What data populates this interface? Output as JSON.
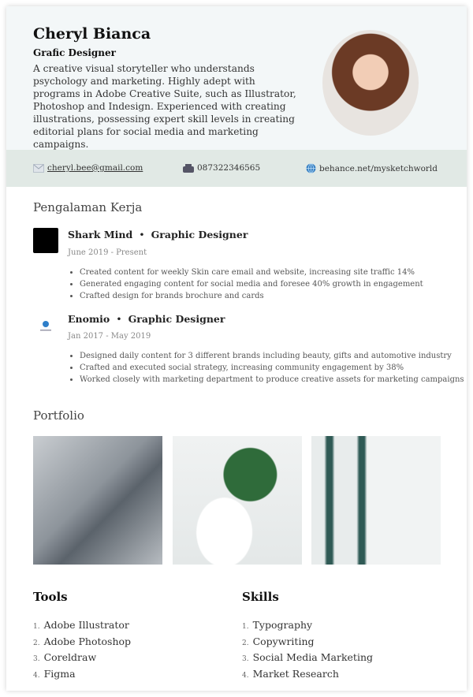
{
  "header": {
    "name": "Cheryl Bianca",
    "title": "Grafic Designer",
    "bio": "A creative visual storyteller who understands psychology and marketing. Highly adept with programs in Adobe Creative Suite, such as Illustrator, Photoshop and Indesign. Experienced with creating illustrations, possessing expert skill levels in creating editorial plans for social media and marketing campaigns."
  },
  "contacts": {
    "email": "cheryl.bee@gmail.com",
    "phone": "087322346565",
    "website": "behance.net/mysketchworld"
  },
  "experience": {
    "heading": "Pengalaman Kerja",
    "jobs": [
      {
        "company": "Shark Mind",
        "role": "Graphic Designer",
        "dates": "June 2019 - Present",
        "bullets": [
          "Created content for weekly Skin care email and website, increasing site traffic 14%",
          "Generated engaging content for social media and foresee  40% growth in engagement",
          "Crafted design for brands brochure and cards"
        ]
      },
      {
        "company": "Enomio",
        "role": "Graphic Designer",
        "dates": "Jan 2017 - May 2019",
        "bullets": [
          "Designed daily content for 3 different brands including beauty, gifts and automotive industry",
          "Crafted and executed social strategy, increasing community engagement by 38%",
          "Worked closely with marketing department to produce creative assets for marketing campaigns"
        ]
      }
    ]
  },
  "portfolio": {
    "heading": "Portfolio"
  },
  "tools": {
    "heading": "Tools",
    "items": [
      "Adobe Illustrator",
      "Adobe Photoshop",
      "Coreldraw",
      "Figma"
    ]
  },
  "skills": {
    "heading": "Skills",
    "items": [
      "Typography",
      "Copywriting",
      "Social Media Marketing",
      "Market Research"
    ]
  },
  "separator": "•",
  "numbers": [
    "1.",
    "2.",
    "3.",
    "4."
  ]
}
